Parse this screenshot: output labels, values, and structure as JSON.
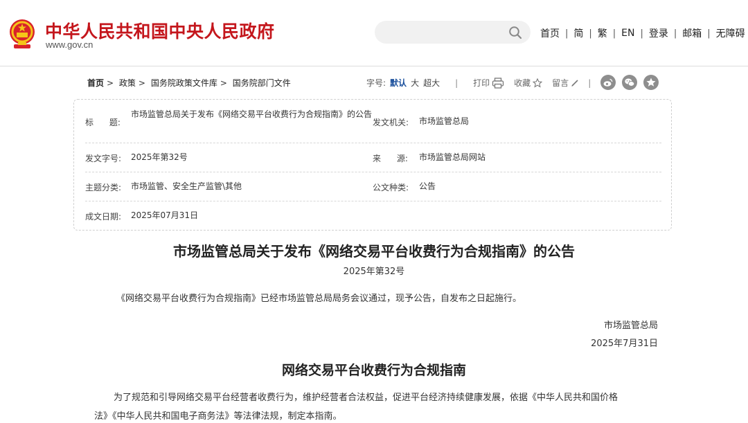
{
  "header": {
    "title": "中华人民共和国中央人民政府",
    "url": "www.gov.cn",
    "search_placeholder": "",
    "nav": [
      "首页",
      "简",
      "繁",
      "EN",
      "登录",
      "邮箱",
      "无障碍"
    ]
  },
  "breadcrumb": [
    "首页",
    "政策",
    "国务院政策文件库",
    "国务院部门文件"
  ],
  "tools": {
    "font_label": "字号:",
    "font_sizes": [
      "默认",
      "大",
      "超大"
    ],
    "print": "打印",
    "favorite": "收藏",
    "comment": "留言"
  },
  "info": {
    "title_label": "标      题:",
    "title_value": "市场监管总局关于发布《网络交易平台收费行为合规指南》的公告",
    "issuer_label": "发文机关:",
    "issuer_value": "市场监管总局",
    "doc_no_label": "发文字号:",
    "doc_no_value": "2025年第32号",
    "source_label": "来      源:",
    "source_value": "市场监管总局网站",
    "topic_label": "主题分类:",
    "topic_value": "市场监管、安全生产监管\\其他",
    "type_label": "公文种类:",
    "type_value": "公告",
    "date_label": "成文日期:",
    "date_value": "2025年07月31日"
  },
  "article": {
    "title": "市场监管总局关于发布《网络交易平台收费行为合规指南》的公告",
    "doc_no": "2025年第32号",
    "intro": "《网络交易平台收费行为合规指南》已经市场监管总局局务会议通过，现予公告，自发布之日起施行。",
    "sign_org": "市场监管总局",
    "sign_date": "2025年7月31日",
    "sub_title": "网络交易平台收费行为合规指南",
    "para1_line1": "为了规范和引导网络交易平台经营者收费行为，维护经营者合法权益，促进平台经济持续健康发展，依据《中华人民共和国价格",
    "para1_line2": "法》《中华人民共和国电子商务法》等法律法规，制定本指南。"
  },
  "colors": {
    "brand_red": "#c4161c",
    "active_blue": "#1a4f9c",
    "icon_gray": "#8e8e8e"
  }
}
